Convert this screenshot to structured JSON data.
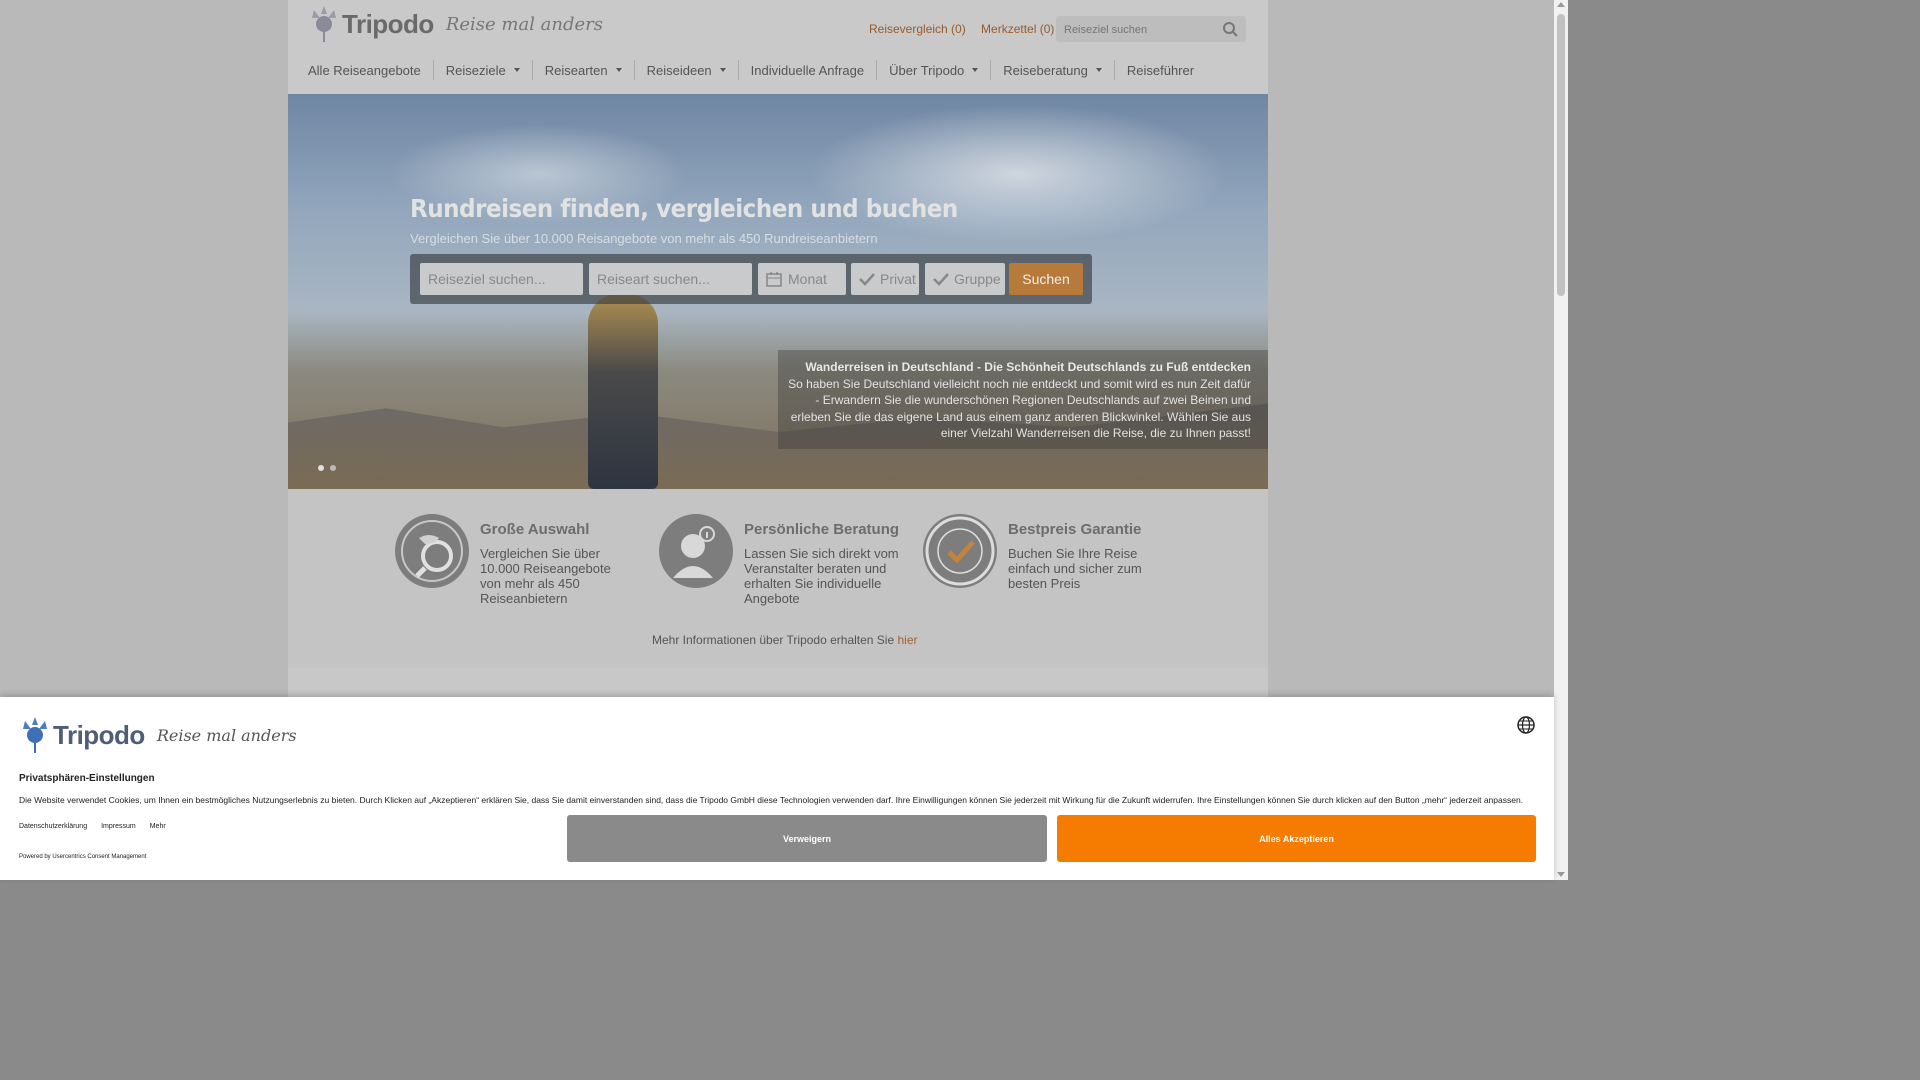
{
  "header": {
    "logo_name": "Tripodo",
    "logo_tagline": "Reise mal anders",
    "compare_link": "Reisevergleich (0)",
    "wishlist_link": "Merkzettel (0)",
    "search_placeholder": "Reiseziel suchen"
  },
  "nav": {
    "items": [
      {
        "label": "Alle Reiseangebote",
        "dropdown": false
      },
      {
        "label": "Reiseziele",
        "dropdown": true
      },
      {
        "label": "Reisearten",
        "dropdown": true
      },
      {
        "label": "Reiseideen",
        "dropdown": true
      },
      {
        "label": "Individuelle Anfrage",
        "dropdown": false
      },
      {
        "label": "Über Tripodo",
        "dropdown": true
      },
      {
        "label": "Reiseberatung",
        "dropdown": true
      },
      {
        "label": "Reiseführer",
        "dropdown": false
      }
    ]
  },
  "hero": {
    "title": "Rundreisen finden, vergleichen und buchen",
    "subtitle": "Vergleichen Sie über 10.000 Reisangebote von mehr als 450 Rundreiseanbietern",
    "search": {
      "destination_placeholder": "Reiseziel suchen...",
      "type_placeholder": "Reiseart suchen...",
      "month_label": "Monat",
      "private_label": "Privat",
      "group_label": "Gruppe",
      "submit_label": "Suchen"
    },
    "promo": {
      "title": "Wanderreisen in Deutschland - Die Schönheit Deutschlands zu Fuß entdecken",
      "text": "So haben Sie Deutschland vielleicht noch nie entdeckt und somit wird es nun Zeit dafür - Erwandern Sie die wunderschönen Regionen Deutschlands auf zwei Beinen und erleben Sie die das eigene Land aus einem ganz anderen Blickwinkel. Wählen Sie aus einer Vielzahl Wanderreisen die Reise, die zu Ihnen passt!"
    }
  },
  "features": [
    {
      "icon": "globe-search-icon",
      "title": "Große Auswahl",
      "text": "Vergleichen Sie über 10.000 Reiseangebote von mehr als 450 Reiseanbietern"
    },
    {
      "icon": "advisor-icon",
      "title": "Persönliche Beratung",
      "text": "Lassen Sie sich direkt vom Veranstalter beraten und erhalten Sie individuelle Angebote"
    },
    {
      "icon": "best-price-seal-icon",
      "title": "Bestpreis Garantie",
      "text": "Buchen Sie Ihre Reise einfach und sicher zum besten Preis"
    }
  ],
  "more_info": {
    "text": "Mehr Informationen über Tripodo erhalten Sie ",
    "link": "hier"
  },
  "consent": {
    "logo_name": "Tripodo",
    "logo_tagline": "Reise mal anders",
    "title": "Privatsphären-Einstellungen",
    "text": "Die Website verwendet Cookies, um Ihnen ein bestmögliches Nutzungserlebnis zu bieten. Durch Klicken auf „Akzeptieren“ erklären Sie, dass Sie damit einverstanden sind, dass die Tripodo GmbH diese Technologien verwenden darf. Ihre Einwilligungen können Sie jederzeit mit Wirkung für die Zukunft widerrufen. Ihre Einstellungen können Sie durch klicken auf den Button „mehr“ jederzeit anpassen.",
    "links": [
      "Datenschutzerklärung",
      "Impressum",
      "Mehr"
    ],
    "powered_by": "Powered by Usercentrics Consent Management",
    "deny_label": "Verweigern",
    "accept_label": "Alles Akzeptieren"
  },
  "colors": {
    "accent": "#f57c00",
    "deny": "#8a8a8a",
    "link": "#a06030"
  }
}
